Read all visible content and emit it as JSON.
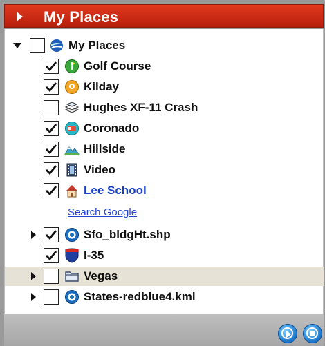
{
  "header": {
    "title": "My Places"
  },
  "tree": {
    "root": {
      "label": "My Places",
      "checked": false,
      "expanded": true,
      "icon": "globe-icon"
    },
    "items": [
      {
        "label": "Golf Course",
        "checked": true,
        "icon": "golf-placemark-icon"
      },
      {
        "label": "Kilday",
        "checked": true,
        "icon": "orange-placemark-icon"
      },
      {
        "label": "Hughes XF-11 Crash",
        "checked": false,
        "icon": "layers-overlay-icon"
      },
      {
        "label": "Coronado",
        "checked": true,
        "icon": "hotel-placemark-icon"
      },
      {
        "label": "Hillside",
        "checked": true,
        "icon": "photo-overlay-icon"
      },
      {
        "label": "Video",
        "checked": true,
        "icon": "video-icon"
      },
      {
        "label": "Lee School",
        "checked": true,
        "icon": "school-icon",
        "link": true
      }
    ],
    "search_link": "Search Google",
    "items2": [
      {
        "label": "Sfo_bldgHt.shp",
        "checked": true,
        "icon": "network-link-icon",
        "expandable": true
      },
      {
        "label": "I-35",
        "checked": true,
        "icon": "interstate-shield-icon"
      },
      {
        "label": "Vegas",
        "checked": false,
        "icon": "folder-icon",
        "expandable": true,
        "highlighted": true
      },
      {
        "label": "States-redblue4.kml",
        "checked": false,
        "icon": "network-link-icon",
        "expandable": true
      }
    ]
  },
  "footer": {
    "buttons": [
      "play-tour-icon",
      "stop-tour-icon"
    ]
  }
}
